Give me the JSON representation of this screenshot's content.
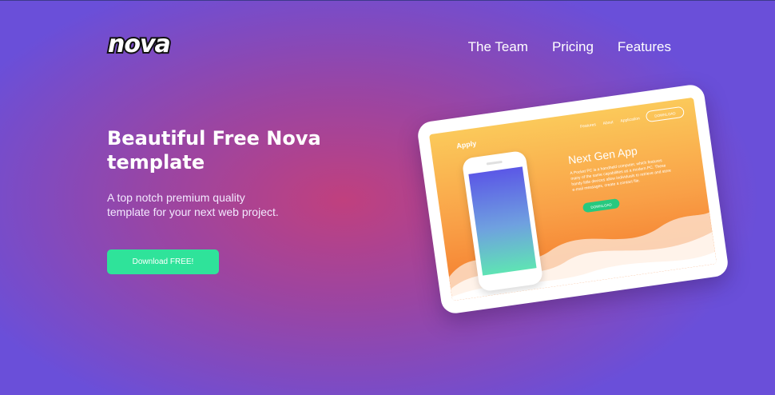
{
  "brand": {
    "logo": "nova"
  },
  "nav": {
    "items": [
      "The Team",
      "Pricing",
      "Features"
    ]
  },
  "hero": {
    "title": "Beautiful Free Nova template",
    "subtitle": "A top notch premium quality template for your next web project.",
    "cta_label": "Download FREE!"
  },
  "mockup": {
    "apply": "Apply",
    "nav": [
      "Features",
      "About",
      "Application"
    ],
    "download_top": "DOWNLOAD",
    "title": "Next Gen App",
    "body": "A Pocket PC is a handheld computer, which features many of the same capabilities as a modern PC. These handy little devices allow individuals to retrieve and store e-mail messages, create a contact file.",
    "download": "DOWNLOAD"
  },
  "colors": {
    "accent": "#2fe39a",
    "background_edge": "#6a4fd9",
    "background_center": "#c0407e"
  }
}
